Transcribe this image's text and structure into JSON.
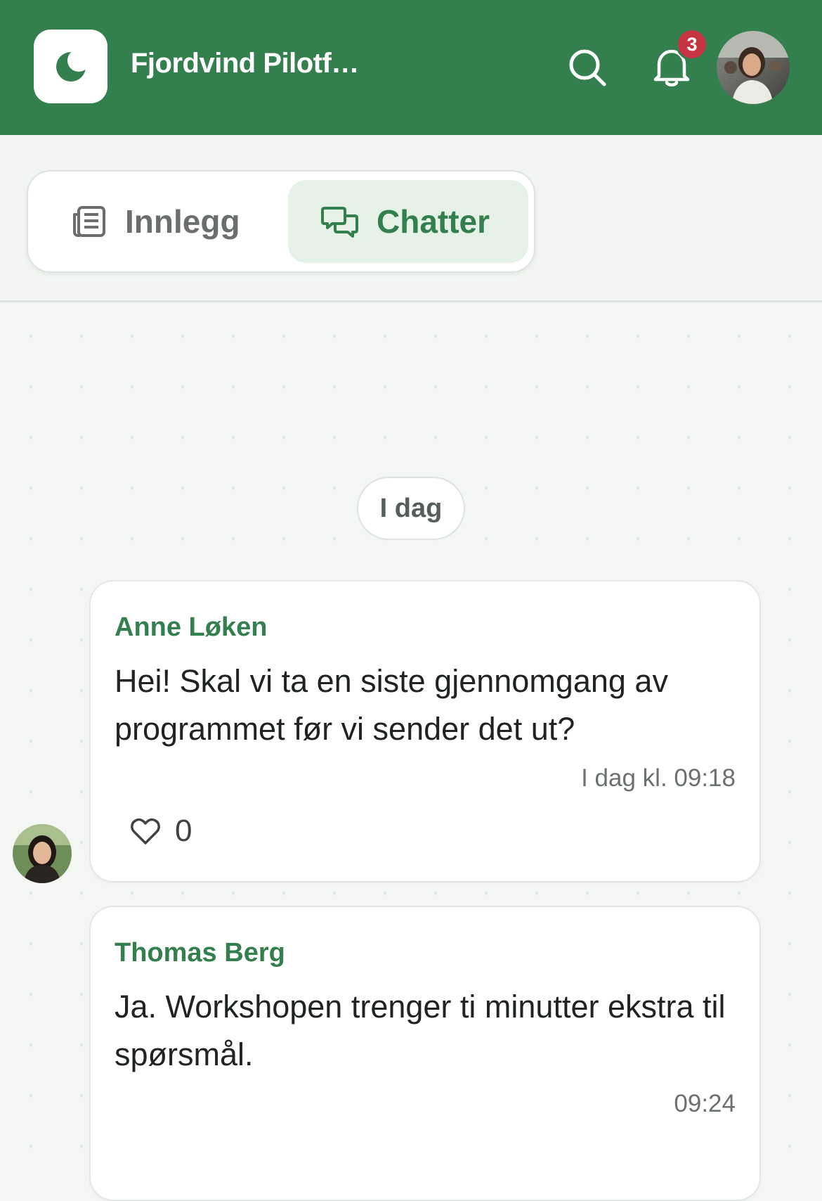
{
  "header": {
    "app_title": "Fjordvind Pilotf…",
    "notification_count": "3",
    "icons": [
      "moon-icon",
      "search-icon",
      "bell-icon"
    ]
  },
  "tabs": [
    {
      "label": "Innlegg",
      "icon": "newspaper-icon",
      "active": false
    },
    {
      "label": "Chatter",
      "icon": "chat-bubbles-icon",
      "active": true
    }
  ],
  "chat": {
    "day_label": "I dag",
    "messages": [
      {
        "sender": "Anne Løken",
        "text": "Hei! Skal vi ta en siste gjennomgang av programmet før vi sender det ut?",
        "time": "I dag kl. 09:18",
        "likes": "0"
      },
      {
        "sender": "Thomas Berg",
        "text": "Ja. Workshopen trenger ti minutter ekstra til spørsmål.",
        "time": "09:24"
      }
    ]
  },
  "colors": {
    "brand_green": "#347f4e",
    "badge_red": "#c63441",
    "active_tab_bg": "#e6f1e8"
  }
}
